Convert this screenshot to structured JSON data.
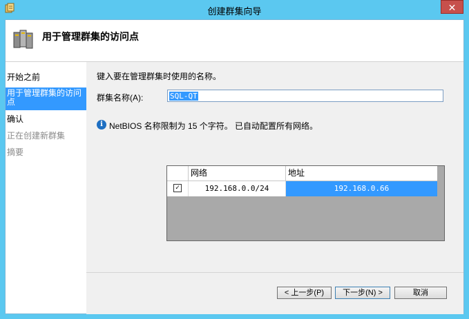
{
  "window": {
    "title": "创建群集向导",
    "close_label": "✕"
  },
  "header": {
    "heading": "用于管理群集的访问点"
  },
  "nav": {
    "items": [
      {
        "label": "开始之前",
        "state": "normal"
      },
      {
        "label": "用于管理群集的访问点",
        "state": "active"
      },
      {
        "label": "确认",
        "state": "normal"
      },
      {
        "label": "正在创建新群集",
        "state": "disabled"
      },
      {
        "label": "摘要",
        "state": "disabled"
      }
    ]
  },
  "form": {
    "instruction": "键入要在管理群集时使用的名称。",
    "cluster_name_label": "群集名称(A):",
    "cluster_name_value": "SQL-QT",
    "info_text": "NetBIOS 名称限制为 15 个字符。 已自动配置所有网络。"
  },
  "network_table": {
    "columns": [
      "网络",
      "地址"
    ],
    "rows": [
      {
        "checked": true,
        "network": "192.168.0.0/24",
        "address": "192.168.0.66"
      }
    ]
  },
  "footer": {
    "back_label": "< 上一步(P)",
    "next_label": "下一步(N) >",
    "cancel_label": "取消"
  },
  "colors": {
    "accent": "#3399ff",
    "window_border": "#5bc8f0",
    "close_button": "#c7504c"
  },
  "icons": {
    "app": "wizard-app-icon",
    "header": "cluster-servers-icon",
    "info": "info-icon",
    "close": "close-icon"
  }
}
